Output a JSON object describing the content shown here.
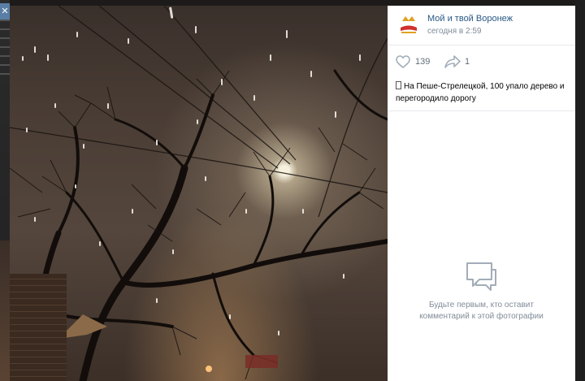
{
  "close_glyph": "✕",
  "post": {
    "group_name": "Мой и твой Воронеж",
    "time": "сегодня в 2:59",
    "likes": "139",
    "shares": "1",
    "text": "На Пеше-Стрелецкой, 100 упало дерево и перегородило дорогу"
  },
  "comments": {
    "empty_line1": "Будьте первым, кто оставит",
    "empty_line2": "комментарий к этой фотографии"
  },
  "icons": [
    "close-icon",
    "heart-icon",
    "share-icon",
    "comment-bubble-icon"
  ],
  "colors": {
    "link": "#2a5885",
    "muted": "#818c99",
    "icon": "#a3adb8"
  }
}
